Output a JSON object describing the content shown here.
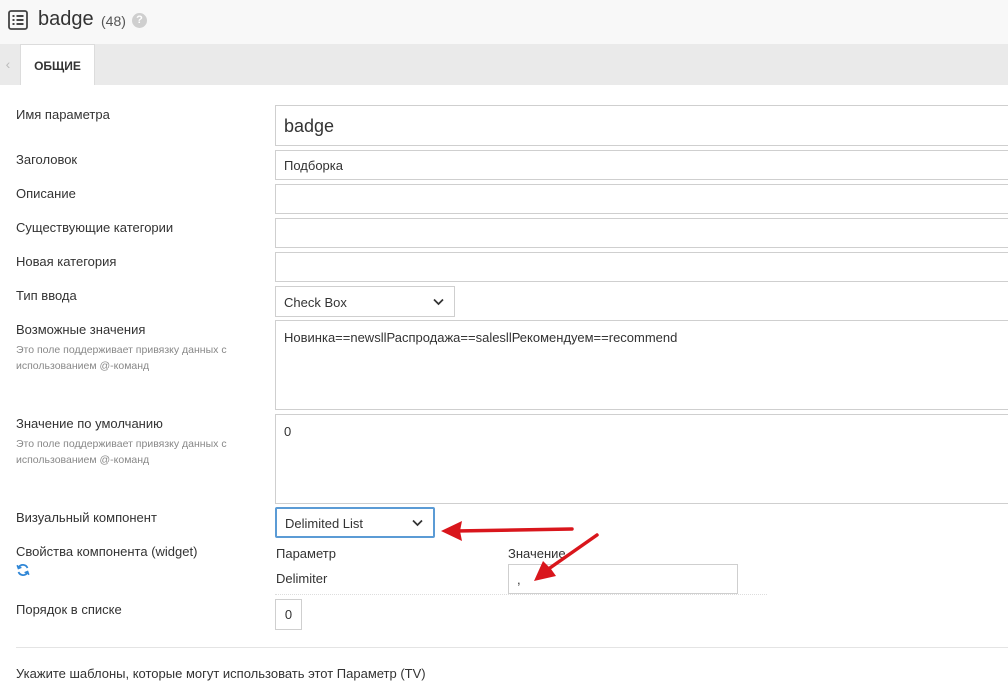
{
  "header": {
    "title": "badge",
    "count": "(48)",
    "help": "?",
    "icon": "list-icon"
  },
  "tabs": {
    "prev": "‹",
    "active": "ОБЩИЕ"
  },
  "form": {
    "name": {
      "label": "Имя параметра",
      "value": "badge"
    },
    "caption": {
      "label": "Заголовок",
      "value": "Подборка"
    },
    "description": {
      "label": "Описание",
      "value": ""
    },
    "existing_categories": {
      "label": "Существующие категории",
      "value": ""
    },
    "new_category": {
      "label": "Новая категория",
      "value": ""
    },
    "input_type": {
      "label": "Тип ввода",
      "value": "Check Box"
    },
    "input_options": {
      "label": "Возможные значения",
      "hint": "Это поле поддерживает привязку данных с использованием @-команд",
      "value": "Новинка==newsllРаспродажа==salesllРекомендуем==recommend"
    },
    "default_value": {
      "label": "Значение по умолчанию",
      "hint": "Это поле поддерживает привязку данных с использованием @-команд",
      "value": "0"
    },
    "widget": {
      "label": "Визуальный компонент",
      "value": "Delimited List"
    },
    "widget_props": {
      "label": "Свойства компонента (widget)",
      "col_param": "Параметр",
      "col_value": "Значение",
      "row_param": "Delimiter",
      "row_value": ","
    },
    "rank": {
      "label": "Порядок в списке",
      "value": "0"
    },
    "templates_label": "Укажите шаблоны, которые могут использовать этот Параметр (TV)"
  },
  "colors": {
    "accent_focus": "#5b9bd5",
    "annotation_arrow": "#d9161c",
    "refresh_icon": "#2f86d6"
  }
}
